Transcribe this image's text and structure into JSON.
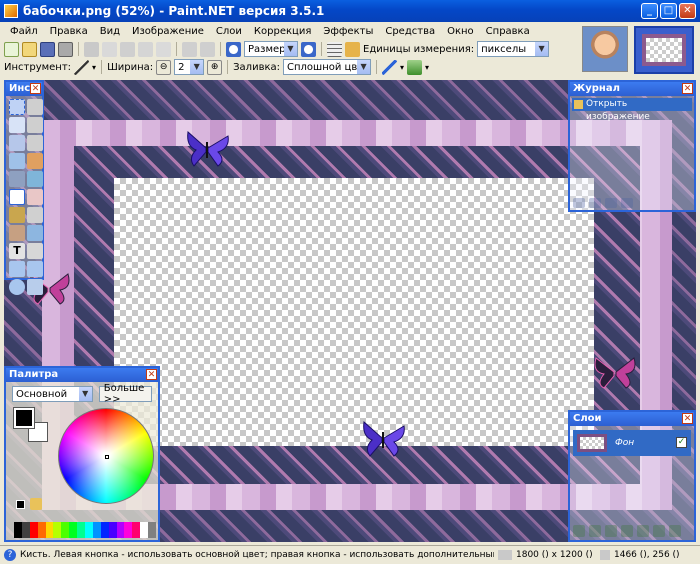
{
  "window": {
    "title": "бабочки.png (52%) - Paint.NET версия 3.5.1"
  },
  "menu": [
    "Файл",
    "Правка",
    "Вид",
    "Изображение",
    "Слои",
    "Коррекция",
    "Эффекты",
    "Средства",
    "Окно",
    "Справка"
  ],
  "toolbar": {
    "zoom_value": "Размер окна",
    "units_label": "Единицы измерения:",
    "units_value": "пикселы"
  },
  "tool_options": {
    "tool_label": "Инструмент:",
    "width_label": "Ширина:",
    "width_value": "2",
    "fill_label": "Заливка:",
    "fill_value": "Сплошной цвет"
  },
  "tools_panel": {
    "title": "Инс..."
  },
  "journal": {
    "title": "Журнал",
    "items": [
      "Открыть изображение"
    ]
  },
  "palette": {
    "title": "Палитра",
    "mode": "Основной",
    "more_button": "Больше >>"
  },
  "layers": {
    "title": "Слои",
    "items": [
      {
        "name": "Фон",
        "visible": true
      }
    ]
  },
  "status": {
    "hint": "Кисть. Левая кнопка - использовать основной цвет; правая кнопка - использовать дополнительный цвет.",
    "image_size": "1800 () x 1200 ()",
    "cursor_pos": "1466 (), 256 ()"
  },
  "colors": {
    "primary": "#000000",
    "secondary": "#FFFFFF",
    "accent": "#2C64D8"
  },
  "palette_colors": [
    "#000000",
    "#404040",
    "#FF0000",
    "#FF6A00",
    "#FFD800",
    "#B6FF00",
    "#4CFF00",
    "#00FF21",
    "#00FF90",
    "#00FFFF",
    "#0094FF",
    "#0026FF",
    "#4800FF",
    "#B200FF",
    "#FF00DC",
    "#FF006E",
    "#FFFFFF",
    "#808080"
  ]
}
